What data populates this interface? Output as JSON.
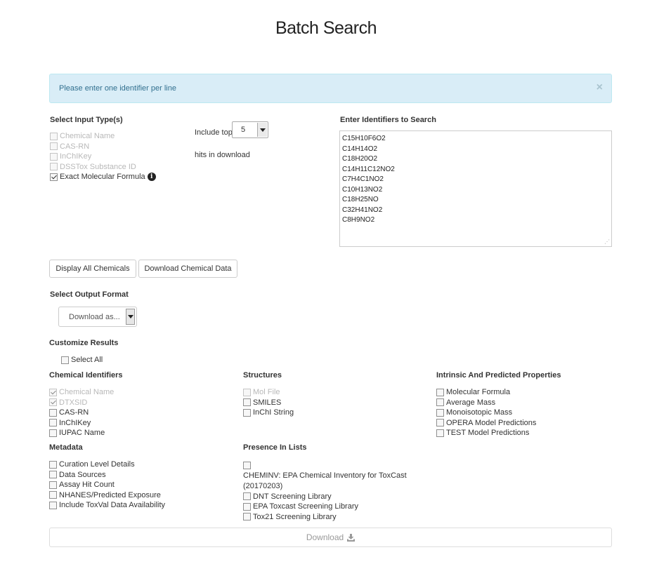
{
  "page": {
    "title": "Batch Search"
  },
  "alert": {
    "text": "Please enter one identifier per line",
    "close": "×"
  },
  "input_types": {
    "heading": "Select Input Type(s)",
    "items": [
      {
        "label": "Chemical Name",
        "checked": false,
        "disabled": true
      },
      {
        "label": "CAS-RN",
        "checked": false,
        "disabled": true
      },
      {
        "label": "InChIKey",
        "checked": false,
        "disabled": true
      },
      {
        "label": "DSSTox Substance ID",
        "checked": false,
        "disabled": true
      },
      {
        "label": "Exact Molecular Formula",
        "checked": true,
        "disabled": false
      }
    ]
  },
  "include_top": {
    "prefix": "Include top",
    "value": "5",
    "suffix": "hits in download"
  },
  "identifiers": {
    "heading": "Enter Identifiers to Search",
    "lines": [
      "C15H10F6O2",
      "C14H14O2",
      "C18H20O2",
      "C14H11C12NO2",
      "C7H4C1NO2",
      "C10H13NO2",
      "C18H25NO",
      "C32H41NO2",
      "C8H9NO2"
    ]
  },
  "buttons": {
    "display_all": "Display All Chemicals",
    "download_data": "Download Chemical Data"
  },
  "output_format": {
    "heading": "Select Output Format",
    "value": "Download as..."
  },
  "customize": {
    "heading": "Customize Results",
    "select_all": "Select All",
    "chemical_identifiers": {
      "heading": "Chemical Identifiers",
      "items": [
        {
          "label": "Chemical Name",
          "checked": true,
          "disabled": true
        },
        {
          "label": "DTXSID",
          "checked": true,
          "disabled": true
        },
        {
          "label": "CAS-RN",
          "checked": false,
          "disabled": false
        },
        {
          "label": "InChIKey",
          "checked": false,
          "disabled": false
        },
        {
          "label": "IUPAC Name",
          "checked": false,
          "disabled": false
        }
      ]
    },
    "structures": {
      "heading": "Structures",
      "items": [
        {
          "label": "Mol File",
          "checked": false,
          "disabled": true
        },
        {
          "label": "SMILES",
          "checked": false,
          "disabled": false
        },
        {
          "label": "InChI String",
          "checked": false,
          "disabled": false
        }
      ]
    },
    "properties": {
      "heading": "Intrinsic And Predicted Properties",
      "items": [
        {
          "label": "Molecular Formula",
          "checked": false,
          "disabled": false
        },
        {
          "label": "Average Mass",
          "checked": false,
          "disabled": false
        },
        {
          "label": "Monoisotopic Mass",
          "checked": false,
          "disabled": false
        },
        {
          "label": "OPERA Model Predictions",
          "checked": false,
          "disabled": false
        },
        {
          "label": "TEST Model Predictions",
          "checked": false,
          "disabled": false
        }
      ]
    },
    "metadata": {
      "heading": "Metadata",
      "items": [
        {
          "label": "Curation Level Details",
          "checked": false,
          "disabled": false
        },
        {
          "label": "Data Sources",
          "checked": false,
          "disabled": false
        },
        {
          "label": "Assay Hit Count",
          "checked": false,
          "disabled": false
        },
        {
          "label": "NHANES/Predicted Exposure",
          "checked": false,
          "disabled": false
        },
        {
          "label": "Include ToxVal Data Availability",
          "checked": false,
          "disabled": false
        }
      ]
    },
    "presence": {
      "heading": "Presence In Lists",
      "cheminv_line1": "CHEMINV: EPA Chemical Inventory for ToxCast",
      "cheminv_line2": "(20170203)",
      "items": [
        {
          "label": "DNT Screening Library",
          "checked": false,
          "disabled": false
        },
        {
          "label": "EPA Toxcast Screening Library",
          "checked": false,
          "disabled": false
        },
        {
          "label": "Tox21 Screening Library",
          "checked": false,
          "disabled": false
        }
      ]
    }
  },
  "download_button": {
    "label": "Download"
  },
  "icons": {
    "info": "info-icon",
    "download": "download-icon",
    "close": "close-icon"
  }
}
